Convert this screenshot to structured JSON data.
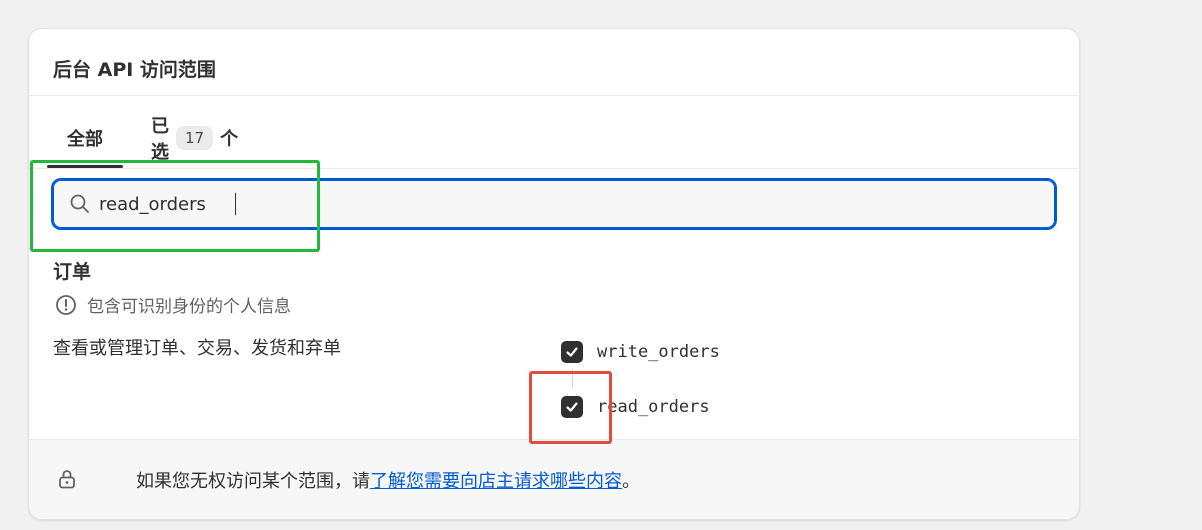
{
  "card": {
    "title": "后台 API 访问范围"
  },
  "tabs": {
    "all_label": "全部",
    "selected_prefix": "已选",
    "selected_count": "17",
    "selected_suffix": "个"
  },
  "search": {
    "value": "read_orders",
    "icon": "search-icon"
  },
  "section": {
    "title": "订单",
    "pii_notice": "包含可识别身份的个人信息",
    "pii_icon": "alert-circle-icon",
    "description": "查看或管理订单、交易、发货和弃单",
    "scopes": [
      {
        "label": "write_orders",
        "checked": true
      },
      {
        "label": "read_orders",
        "checked": true
      }
    ]
  },
  "footer": {
    "icon": "lock-icon",
    "text_prefix": "如果您无权访问某个范围，请",
    "link_text": "了解您需要向店主请求哪些内容",
    "text_suffix": "。"
  },
  "colors": {
    "accent": "#005bd3",
    "checkbox": "#303030",
    "highlight_green": "#22b83a",
    "highlight_red": "#e54b3c"
  }
}
